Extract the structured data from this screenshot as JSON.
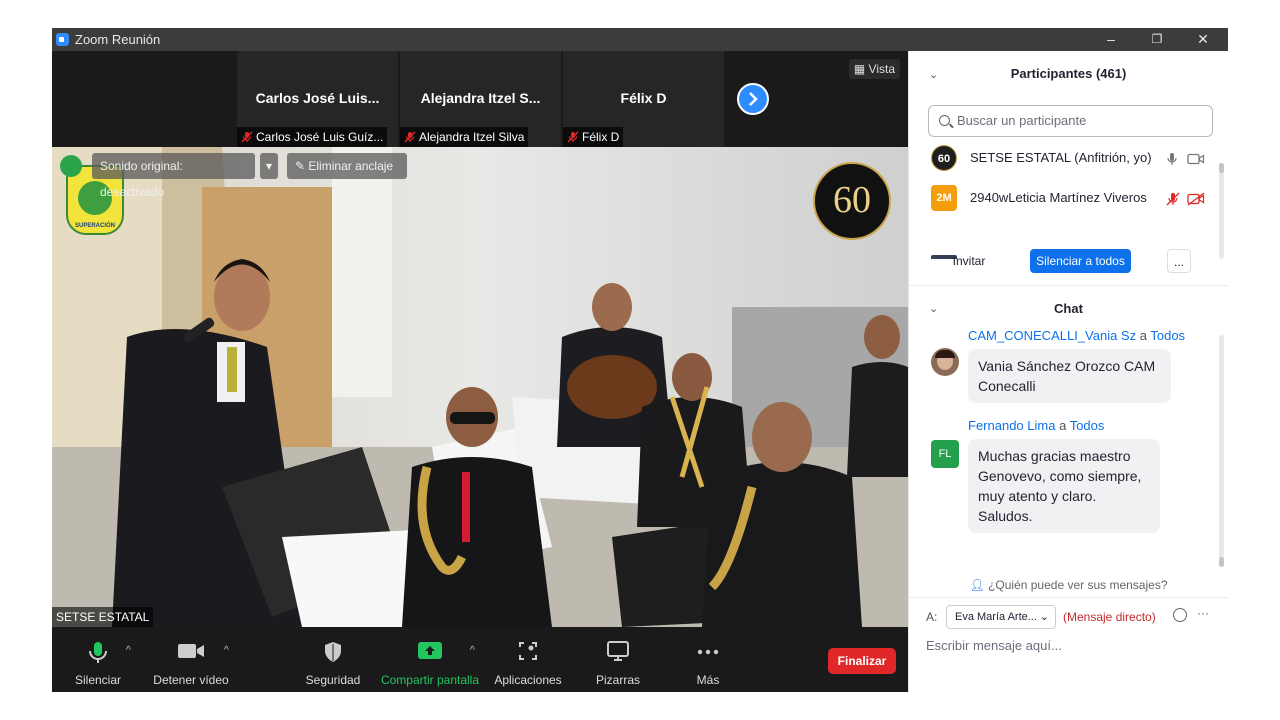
{
  "window": {
    "title": "Zoom Reunión",
    "controls": [
      "–",
      "❐",
      "✕"
    ]
  },
  "strip": {
    "tiles": [
      {
        "name": "Carlos José Luis...",
        "footer": "Carlos José Luis Guíz..."
      },
      {
        "name": "Alejandra Itzel S...",
        "footer": "Alejandra Itzel Silva"
      },
      {
        "name": "Félix D",
        "footer": "Félix D"
      }
    ],
    "view_label": "Vista"
  },
  "main_video": {
    "original_sound": "Sonido original: desactivado",
    "unpin": "Eliminar anclaje",
    "speaker_label": "SETSE ESTATAL",
    "badge_number": "60",
    "logo_text": "SUPERACIÓN"
  },
  "toolbar": {
    "mute": "Silenciar",
    "stop_video": "Detener vídeo",
    "security": "Seguridad",
    "share": "Compartir pantalla",
    "apps": "Aplicaciones",
    "whiteboards": "Pizarras",
    "more": "Más",
    "end": "Finalizar",
    "colors": {
      "share_green": "#22c55e",
      "end_red": "#e02828"
    }
  },
  "participants": {
    "title": "Participantes (461)",
    "search_placeholder": "Buscar un participante",
    "list": [
      {
        "avatar": "60",
        "name": "SETSE ESTATAL (Anfitrión, yo)",
        "color": "#1f1f1f"
      },
      {
        "avatar": "2M",
        "name": "2940wLeticia Martínez Viveros",
        "color": "#f59e0b"
      }
    ],
    "invite": "Invitar",
    "mute_all": "Silenciar a todos",
    "more": "..."
  },
  "chat": {
    "title": "Chat",
    "messages": [
      {
        "sender": "CAM_CONECALLI_Vania Sz",
        "to": "a",
        "target": "Todos",
        "text": "Vania Sánchez Orozco CAM Conecalli"
      },
      {
        "sender": "Fernando Lima",
        "to": "a",
        "target": "Todos",
        "avatar": "FL",
        "lines": [
          "Muchas gracias maestro",
          "Genovevo, como siempre,",
          "muy atento y claro.",
          "Saludos."
        ]
      }
    ],
    "who_can_see": "¿Quién puede ver sus mensajes?",
    "to_label": "A:",
    "recipient": "Eva María Arte...",
    "direct": "(Mensaje directo)",
    "input_placeholder": "Escribir mensaje aquí..."
  }
}
